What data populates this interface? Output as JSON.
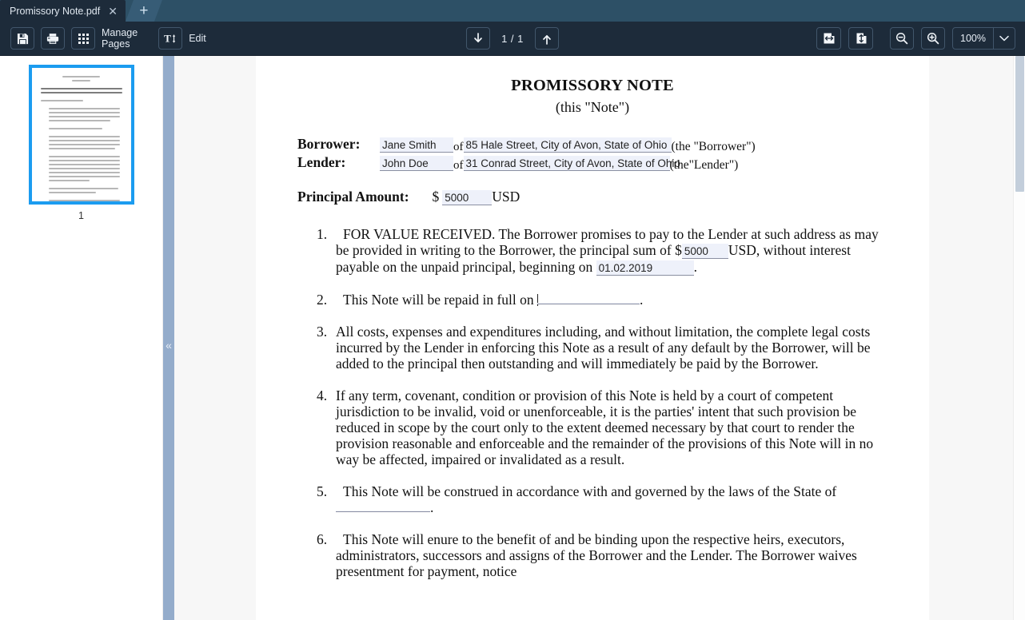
{
  "tabbar": {
    "tabs": [
      {
        "title": "Promissory Note.pdf",
        "close_label": "✕"
      }
    ],
    "new_tab_label": "+"
  },
  "toolbar": {
    "save_label": "save-icon",
    "print_label": "print-icon",
    "manage_pages_label_line1": "Manage",
    "manage_pages_label_line2": "Pages",
    "edit_label": "Edit",
    "page_indicator": "1 / 1",
    "prev_page_label": "previous-page",
    "next_page_label": "next-page",
    "fit_width_label": "fit-width",
    "fit_page_label": "fit-page",
    "zoom_out_label": "zoom-out",
    "zoom_in_label": "zoom-in",
    "zoom_value": "100%",
    "zoom_caret": "⌄",
    "accent_color": "#1d2b3a",
    "border_color": "#41566b"
  },
  "sidebar": {
    "thumbnails": [
      {
        "page_number": "1",
        "selected": true,
        "highlight_color": "#1b9cf0"
      }
    ],
    "collapse_label": "«"
  },
  "document": {
    "title": "PROMISSORY NOTE",
    "subtitle": "(this \"Note\")",
    "parties": [
      {
        "label": "Borrower:",
        "name_value": "Jane Smith",
        "of_text": "of",
        "address_value": "85 Hale Street, City of Avon, State of Ohio",
        "suffix": "(the \"Borrower\")"
      },
      {
        "label": "Lender:",
        "name_value": "John Doe",
        "of_text": "of",
        "address_value": "31 Conrad Street, City of Avon, State of Ohio",
        "suffix": "(the\"Lender\")"
      }
    ],
    "principal": {
      "label": "Principal Amount:",
      "currency_symbol": "$",
      "value": "5000",
      "currency_code": "USD"
    },
    "clauses": [
      {
        "number": "1.",
        "text_a": "FOR VALUE RECEIVED. The Borrower promises to pay to the Lender at such address as may be provided in writing to the Borrower, the principal sum of $",
        "field_amount": "5000",
        "text_b": "USD, without interest payable on the unpaid principal, beginning on",
        "field_date": "01.02.2019",
        "text_c": "."
      },
      {
        "number": "2.",
        "text_a": "This Note will be repaid in full on",
        "field_blank": "",
        "text_b": "."
      },
      {
        "number": "3.",
        "text_a": "All costs, expenses and expenditures including, and without limitation, the complete legal costs incurred by the Lender in enforcing this Note as a result of any default by the Borrower, will be added to the principal then outstanding and will immediately be paid by the Borrower."
      },
      {
        "number": "4.",
        "text_a": "If any term, covenant, condition or provision of this Note is held by a court of competent jurisdiction to be invalid, void or unenforceable, it is the parties' intent that such provision be reduced in scope by the court only to the extent deemed necessary by that court to render the provision reasonable and enforceable and the remainder of the provisions of this Note will in no way be affected, impaired or invalidated as a result."
      },
      {
        "number": "5.",
        "text_a": "This Note will be construed in accordance with and governed by the laws of the State of",
        "field_blank": "",
        "text_b": "."
      },
      {
        "number": "6.",
        "text_a": "This Note will enure to the benefit of and be binding upon the respective heirs, executors, administrators, successors and assigns of the Borrower and the Lender. The Borrower waives presentment for payment, notice"
      }
    ],
    "field_fill_color": "#eef1fa"
  }
}
